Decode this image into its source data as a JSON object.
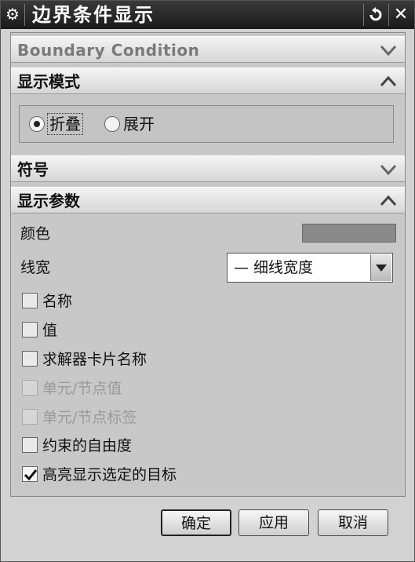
{
  "window": {
    "title": "边界条件显示",
    "app_icon": "gear-icon",
    "reset_icon": "reset-icon",
    "close_icon": "close-icon"
  },
  "sections": {
    "boundary_condition": {
      "label": "Boundary Condition",
      "state": "collapsed"
    },
    "display_mode": {
      "label": "显示模式",
      "state": "expanded"
    },
    "symbol": {
      "label": "符号",
      "state": "collapsed"
    },
    "display_params": {
      "label": "显示参数",
      "state": "expanded"
    }
  },
  "display_mode": {
    "options": [
      "折叠",
      "展开"
    ],
    "selected": "折叠"
  },
  "params": {
    "color_label": "颜色",
    "color_value": "#8a8a8a",
    "line_width_label": "线宽",
    "line_width_value": "— 细线宽度"
  },
  "checkboxes": [
    {
      "label": "名称",
      "checked": false,
      "enabled": true
    },
    {
      "label": "值",
      "checked": false,
      "enabled": true
    },
    {
      "label": "求解器卡片名称",
      "checked": false,
      "enabled": true
    },
    {
      "label": "单元/节点值",
      "checked": false,
      "enabled": false
    },
    {
      "label": "单元/节点标签",
      "checked": false,
      "enabled": false
    },
    {
      "label": "约束的自由度",
      "checked": false,
      "enabled": true
    },
    {
      "label": "高亮显示选定的目标",
      "checked": true,
      "enabled": true
    }
  ],
  "buttons": {
    "ok": "确定",
    "apply": "应用",
    "cancel": "取消"
  }
}
